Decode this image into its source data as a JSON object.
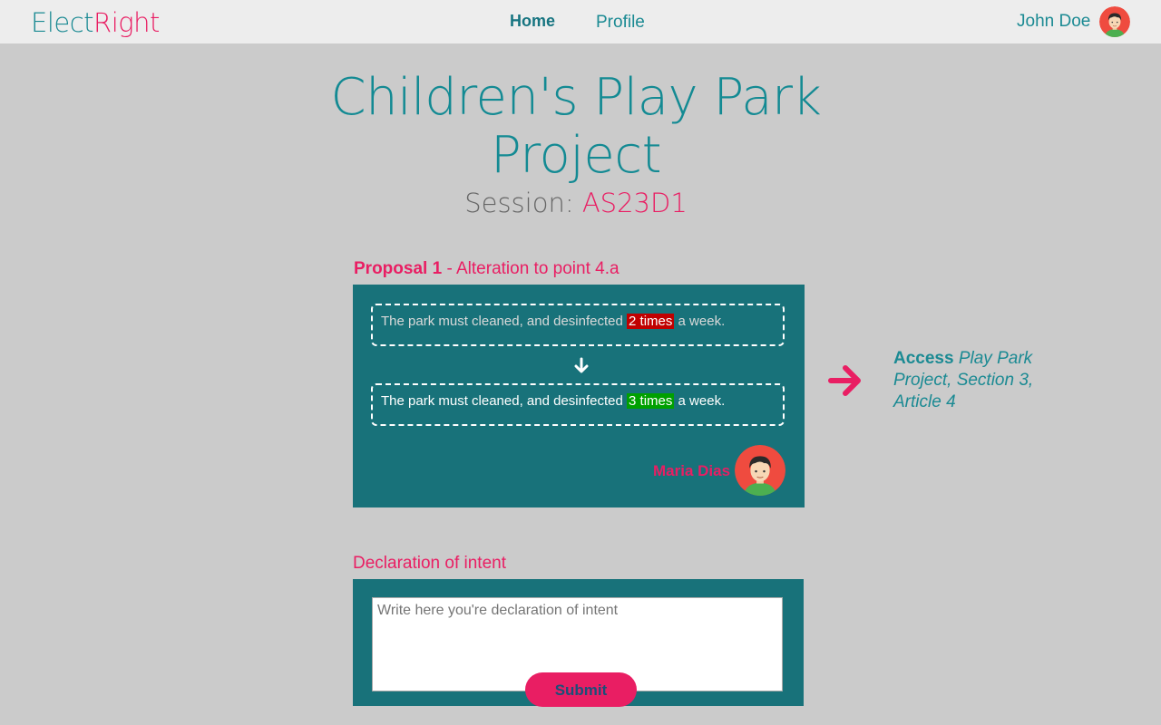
{
  "brand": {
    "part1": "Elect",
    "part2": "Right"
  },
  "nav": {
    "home": "Home",
    "profile": "Profile"
  },
  "user": {
    "name": "John Doe"
  },
  "project": {
    "title": "Children's Play Park Project",
    "session_label": "Session:",
    "session_code": "AS23D1"
  },
  "proposal": {
    "label": "Proposal 1",
    "separator": "-",
    "subtitle": "Alteration to point 4.a",
    "old_text_before": "The park must cleaned, and desinfected",
    "old_highlight": "2 times",
    "old_text_after": "a week.",
    "new_text_before": "The park must cleaned, and desinfected",
    "new_highlight": "3 times",
    "new_text_after": "a week.",
    "author": "Maria Dias"
  },
  "access": {
    "label": "Access",
    "target": "Play Park Project, Section 3, Article 4"
  },
  "declaration": {
    "heading": "Declaration of intent",
    "placeholder": "Write here you're declaration of intent",
    "value": "",
    "submit_label": "Submit"
  },
  "colors": {
    "teal": "#18727a",
    "teal_text": "#1b8a93",
    "pink": "#e91e63",
    "background": "#cbcbcb",
    "old_highlight": "#c00000",
    "new_highlight": "#00a000"
  },
  "icons": [
    "user-avatar-icon",
    "arrow-down-icon",
    "arrow-right-icon"
  ]
}
